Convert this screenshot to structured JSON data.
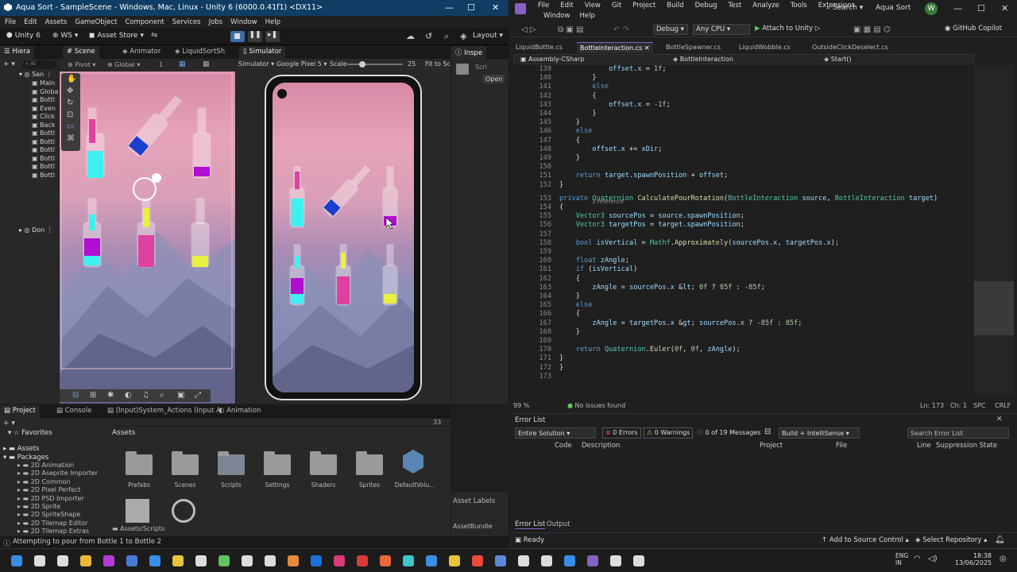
{
  "unity": {
    "title": "Aqua Sort - SampleScene - Windows, Mac, Linux - Unity 6 (6000.0.41f1) <DX11>",
    "menu": [
      "File",
      "Edit",
      "Assets",
      "GameObject",
      "Component",
      "Services",
      "Jobs",
      "Window",
      "Help"
    ],
    "toolbar": {
      "account": "Unity 6",
      "ws": "WS",
      "store": "Asset Store",
      "layout": "Layout"
    },
    "hierarchy": {
      "tab": "Hiera",
      "search": "Al",
      "root": "San",
      "items": [
        "Main",
        "Globa",
        "Bottl",
        "Even",
        "Click",
        "Back",
        "Bottl",
        "Bottl",
        "Bottl",
        "Bottl",
        "Bottl",
        "Bottl"
      ],
      "dont": "Don"
    },
    "scene": {
      "tab": "Scene",
      "pivot": "Pivot",
      "global": "Global",
      "num": "1"
    },
    "tabs2": {
      "animator": "Animator",
      "liquid": "LiquidSortSh",
      "simulator": "Simulator"
    },
    "sim": {
      "sim_label": "Simulator",
      "device": "Google Pixel 5",
      "scale_label": "Scale",
      "scale_val": "25",
      "fit": "Fit to Sc"
    },
    "inspector": {
      "tab": "Inspe",
      "script": "Scri",
      "open": "Open"
    },
    "project": {
      "tab": "Project",
      "console": "Console",
      "input": "(Input)System_Actions (Input A",
      "animation": "Animation",
      "favorites": "Favorites",
      "assets": "Assets",
      "packages": "Packages",
      "count": "33",
      "packages_list": [
        "2D Animation",
        "2D Aseprite Importer",
        "2D Common",
        "2D Pixel Perfect",
        "2D PSD Importer",
        "2D Sprite",
        "2D SpriteShape",
        "2D Tilemap Editor",
        "2D Tilemap Extras"
      ],
      "folders": [
        "Prefabs",
        "Scenes",
        "Scripts",
        "Settings",
        "Shaders",
        "Sprites",
        "DefaultVolu..."
      ],
      "breadcrumb": "Assets/Scripts",
      "asset_labels": "Asset Labels",
      "asset_bundle": "AssetBundle"
    },
    "status": "Attempting to pour from Bottle 1 to Bottle 2"
  },
  "vs": {
    "menu1": [
      "File",
      "Edit",
      "View",
      "Git",
      "Project",
      "Build",
      "Debug",
      "Test",
      "Analyze",
      "Tools",
      "Extensions"
    ],
    "menu2": [
      "Window",
      "Help"
    ],
    "search": "Search",
    "solution": "Aqua Sort",
    "avatar": "W",
    "config": "Debug",
    "platform": "Any CPU",
    "attach": "Attach to Unity",
    "copilot": "GitHub Copilot",
    "tabs": [
      "LiquidBottle.cs",
      "BottleInteraction.cs",
      "BottleSpawner.cs",
      "LiquidWobble.cs",
      "OutsideClickDeselect.cs"
    ],
    "nav": {
      "assembly": "Assembly-CSharp",
      "class": "BottleInteraction",
      "member": "Start()"
    },
    "refs": "1 reference",
    "code": [
      {
        "n": "139",
        "t": "            offset.x = 1f;"
      },
      {
        "n": "140",
        "t": "        }"
      },
      {
        "n": "141",
        "t": "        else"
      },
      {
        "n": "142",
        "t": "        {"
      },
      {
        "n": "143",
        "t": "            offset.x = -1f;"
      },
      {
        "n": "144",
        "t": "        }"
      },
      {
        "n": "145",
        "t": "    }"
      },
      {
        "n": "146",
        "t": "    else"
      },
      {
        "n": "147",
        "t": "    {"
      },
      {
        "n": "148",
        "t": "        offset.x += xDir;"
      },
      {
        "n": "149",
        "t": "    }"
      },
      {
        "n": "150",
        "t": ""
      },
      {
        "n": "151",
        "t": "    return target.spawnPosition + offset;"
      },
      {
        "n": "152",
        "t": "}"
      },
      {
        "n": "153",
        "t": "private Quaternion CalculatePourRotation(BottleInteraction source, BottleInteraction target)"
      },
      {
        "n": "154",
        "t": "{"
      },
      {
        "n": "155",
        "t": "    Vector3 sourcePos = source.spawnPosition;"
      },
      {
        "n": "156",
        "t": "    Vector3 targetPos = target.spawnPosition;"
      },
      {
        "n": "157",
        "t": ""
      },
      {
        "n": "158",
        "t": "    bool isVertical = Mathf.Approximately(sourcePos.x, targetPos.x);"
      },
      {
        "n": "159",
        "t": ""
      },
      {
        "n": "160",
        "t": "    float zAngle;"
      },
      {
        "n": "161",
        "t": "    if (isVertical)"
      },
      {
        "n": "162",
        "t": "    {"
      },
      {
        "n": "163",
        "t": "        zAngle = sourcePos.x < 0f ? 85f : -85f;"
      },
      {
        "n": "164",
        "t": "    }"
      },
      {
        "n": "165",
        "t": "    else"
      },
      {
        "n": "166",
        "t": "    {"
      },
      {
        "n": "167",
        "t": "        zAngle = targetPos.x > sourcePos.x ? -85f : 85f;"
      },
      {
        "n": "168",
        "t": "    }"
      },
      {
        "n": "169",
        "t": ""
      },
      {
        "n": "170",
        "t": "    return Quaternion.Euler(0f, 0f, zAngle);"
      },
      {
        "n": "171",
        "t": "}"
      },
      {
        "n": "172",
        "t": "}"
      },
      {
        "n": "173",
        "t": ""
      }
    ],
    "zoom": "99 %",
    "issues": "No issues found",
    "ln": "Ln: 173",
    "ch": "Ch: 1",
    "spc": "SPC",
    "crlf": "CRLF",
    "errorlist": {
      "title": "Error List",
      "scope": "Entire Solution",
      "errors": "0 Errors",
      "warnings": "0 Warnings",
      "messages": "0 of 19 Messages",
      "build": "Build + IntelliSense",
      "search": "Search Error List",
      "cols": [
        "Code",
        "Description",
        "Project",
        "File",
        "Line",
        "Suppression State"
      ]
    },
    "bottom_tabs": [
      "Error List",
      "Output"
    ],
    "ready": "Ready",
    "source_control": "Add to Source Control",
    "repo": "Select Repository"
  },
  "taskbar": {
    "lang1": "ENG",
    "lang2": "IN",
    "time": "18:38",
    "date": "13/06/2025"
  }
}
